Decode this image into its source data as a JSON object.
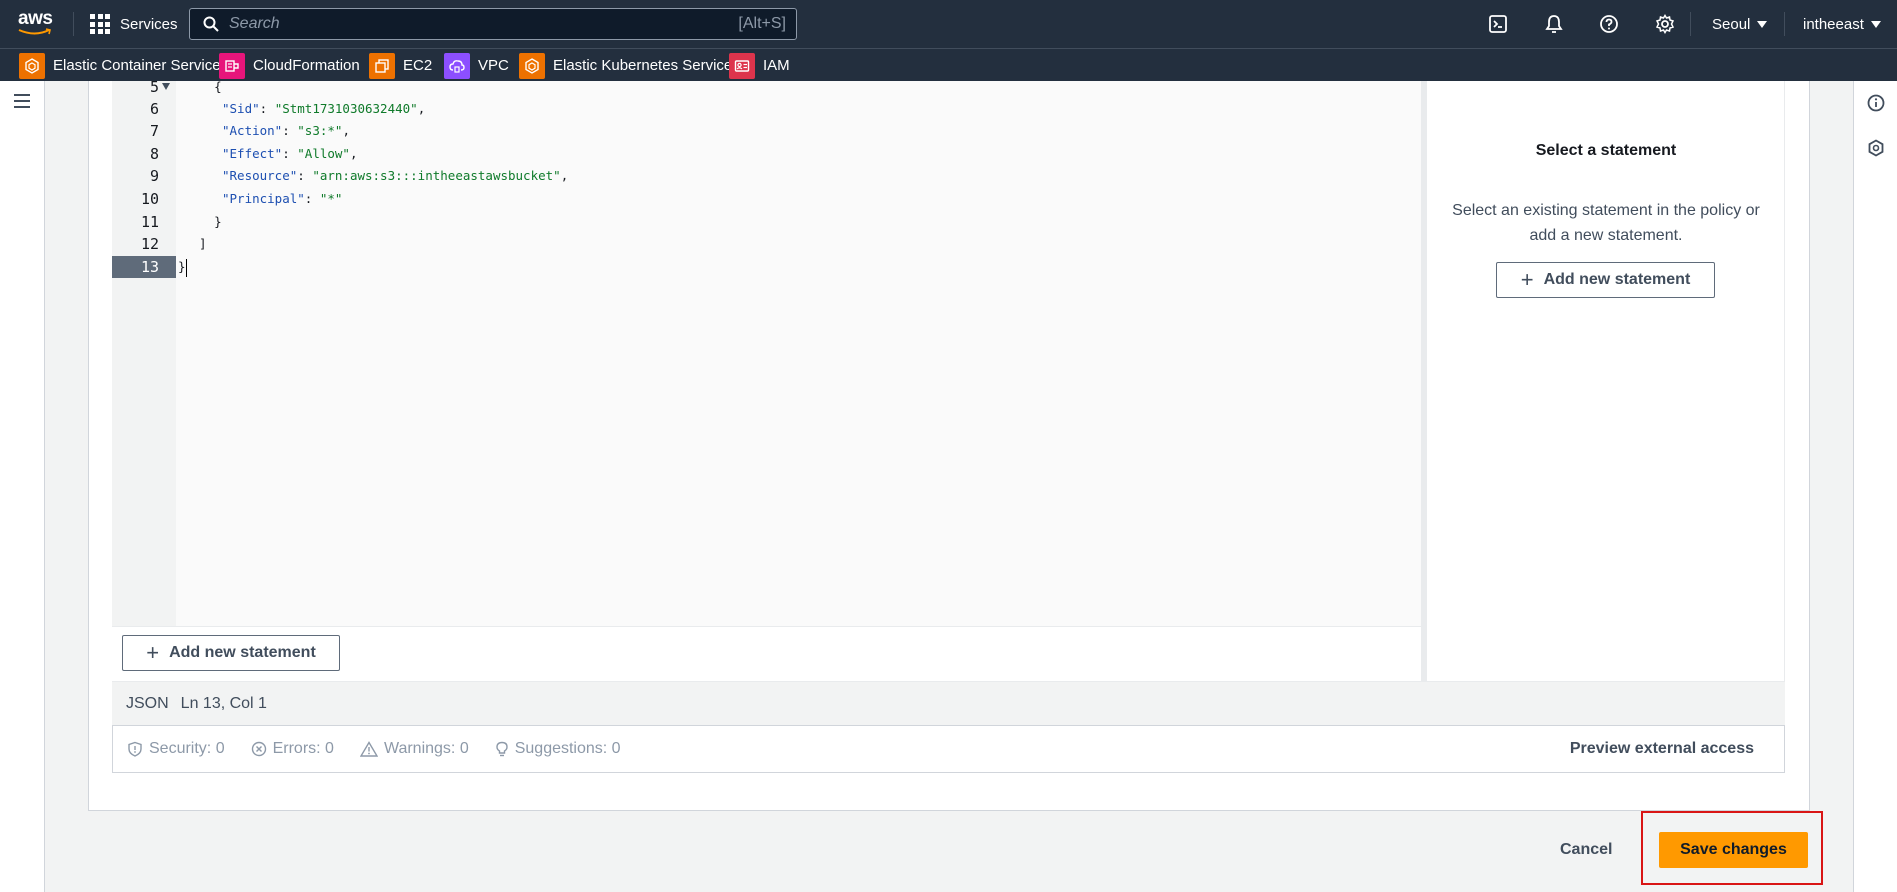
{
  "topnav": {
    "logo_text": "aws",
    "services_label": "Services",
    "search_placeholder": "Search",
    "search_shortcut": "[Alt+S]",
    "region_label": "Seoul",
    "account_label": "intheeast"
  },
  "favorites": [
    {
      "label": "Elastic Container Service",
      "icon": "ecs-icon",
      "color": "#ed7100"
    },
    {
      "label": "CloudFormation",
      "icon": "cloudformation-icon",
      "color": "#e7157b"
    },
    {
      "label": "EC2",
      "icon": "ec2-icon",
      "color": "#ed7100"
    },
    {
      "label": "VPC",
      "icon": "vpc-icon",
      "color": "#8c4fff"
    },
    {
      "label": "Elastic Kubernetes Service",
      "icon": "eks-icon",
      "color": "#ed7100"
    },
    {
      "label": "IAM",
      "icon": "iam-icon",
      "color": "#dd344c"
    }
  ],
  "editor": {
    "line_numbers": [
      "5",
      "6",
      "7",
      "8",
      "9",
      "10",
      "11",
      "12",
      "13"
    ],
    "active_line": "13",
    "code": {
      "l5": "    {",
      "l6_key": "\"Sid\"",
      "l6_val": "\"Stmt1731030632440\"",
      "l7_key": "\"Action\"",
      "l7_val": "\"s3:*\"",
      "l8_key": "\"Effect\"",
      "l8_val": "\"Allow\"",
      "l9_key": "\"Resource\"",
      "l9_val": "\"arn:aws:s3:::intheeastawsbucket\"",
      "l10_key": "\"Principal\"",
      "l10_val": "\"*\"",
      "l11": "    }",
      "l12": "  ]",
      "l13": "}"
    },
    "add_statement_label": "Add new statement"
  },
  "side_panel": {
    "title": "Select a statement",
    "description": "Select an existing statement in the policy or add a new statement.",
    "add_statement_label": "Add new statement"
  },
  "status": {
    "language": "JSON",
    "position": "Ln 13, Col 1"
  },
  "diagnostics": {
    "security": "Security: 0",
    "errors": "Errors: 0",
    "warnings": "Warnings: 0",
    "suggestions": "Suggestions: 0",
    "preview_label": "Preview external access"
  },
  "actions": {
    "cancel_label": "Cancel",
    "save_label": "Save changes",
    "save_color": "#ff9900",
    "highlight_color": "#d91515"
  }
}
